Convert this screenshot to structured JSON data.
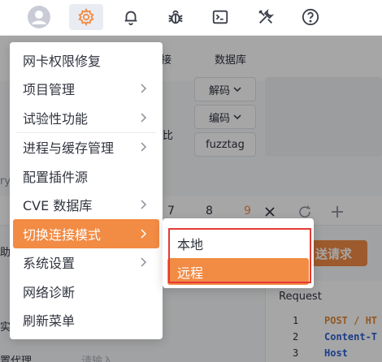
{
  "toolbar": {
    "icons": [
      "user-avatar-icon",
      "gear-icon",
      "bell-icon",
      "bug-icon",
      "terminal-icon",
      "tools-icon",
      "help-icon"
    ],
    "active_icon": "gear-icon"
  },
  "background": {
    "top_fragment": "接",
    "database_tab": "数据库",
    "decode_label": "解码",
    "encode_label": "编码",
    "fuzztag_label": "fuzztag",
    "compare_fragment": "比",
    "left_fragment_1": "ry",
    "left_fragment_2": "助",
    "left_fragment_3": "实",
    "left_fragment_4": "置代理",
    "input_placeholder": "请输入",
    "tabs": [
      "7",
      "8",
      "9"
    ],
    "active_tab": "9",
    "send_button": "送请求",
    "request_title": "Request",
    "code_lines": [
      {
        "no": "1",
        "text": "POST / HT"
      },
      {
        "no": "2",
        "text": "Content-T"
      },
      {
        "no": "3",
        "text": "Host"
      }
    ]
  },
  "menu": {
    "items": [
      {
        "label": "网卡权限修复",
        "submenu": false
      },
      {
        "label": "项目管理",
        "submenu": true
      },
      {
        "label": "试验性功能",
        "submenu": true
      },
      {
        "label": "进程与缓存管理",
        "submenu": true
      },
      {
        "label": "配置插件源",
        "submenu": false
      },
      {
        "label": "CVE 数据库",
        "submenu": true
      },
      {
        "label": "切换连接模式",
        "submenu": true,
        "highlighted": true
      },
      {
        "label": "系统设置",
        "submenu": true
      },
      {
        "label": "网络诊断",
        "submenu": false
      },
      {
        "label": "刷新菜单",
        "submenu": false
      }
    ]
  },
  "submenu": {
    "items": [
      {
        "label": "本地"
      },
      {
        "label": "远程",
        "selected": true
      }
    ]
  },
  "colors": {
    "accent": "#f28b44",
    "highlight_box": "#e53935"
  }
}
